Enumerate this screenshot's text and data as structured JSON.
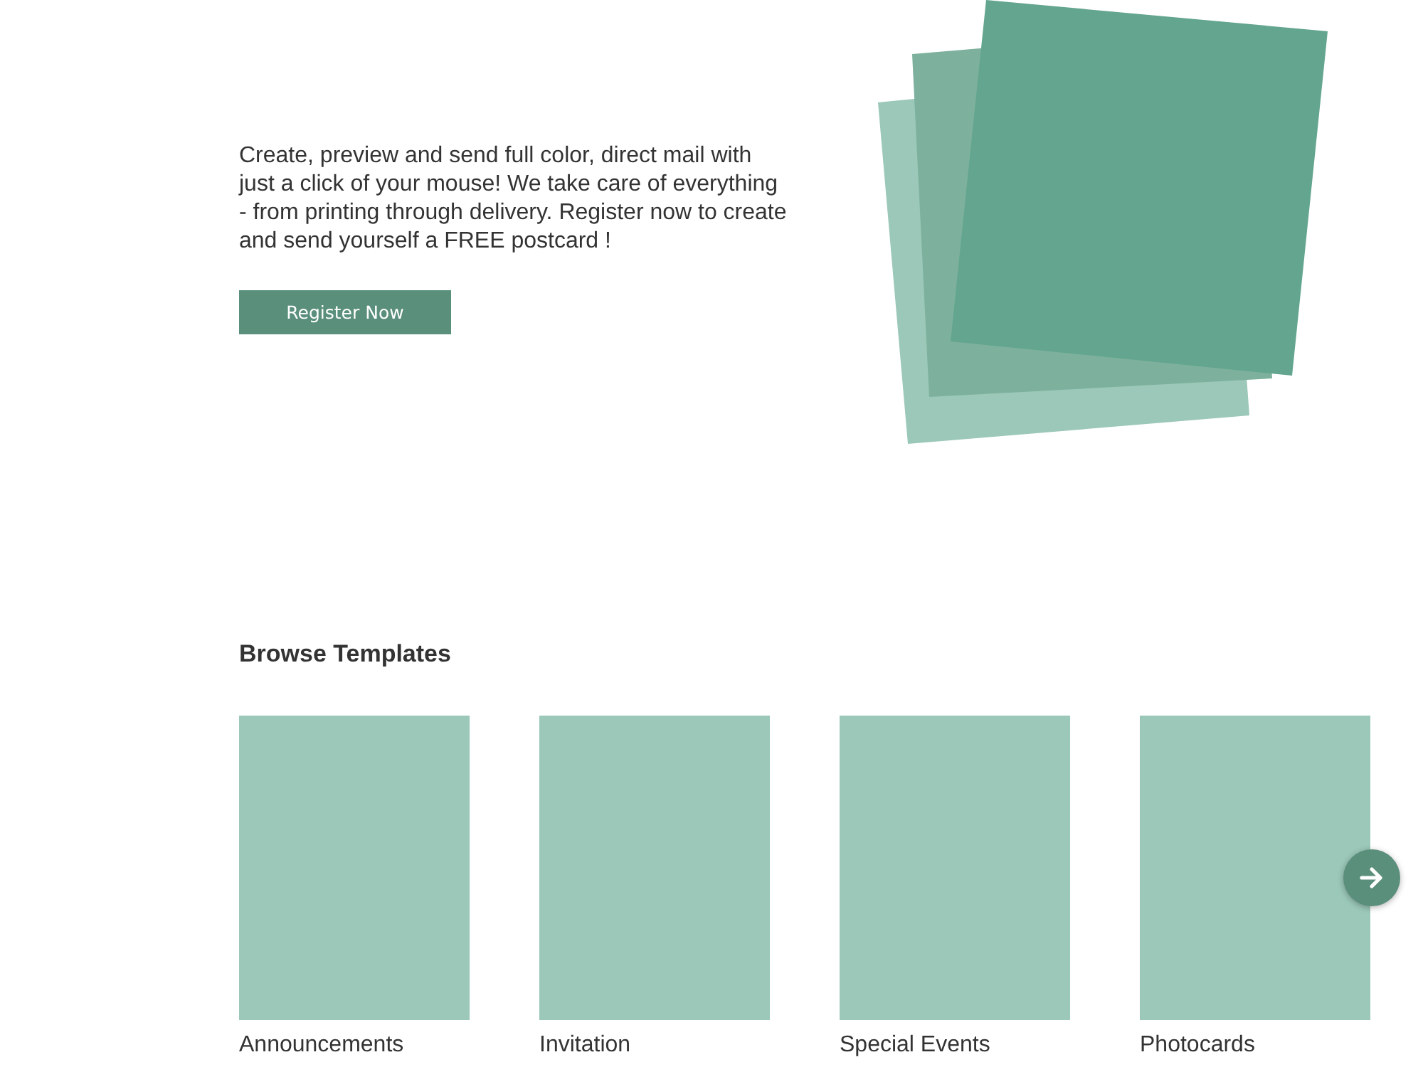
{
  "hero": {
    "description": "Create, preview and send full color, direct mail with just a click of your mouse! We take care of everything - from printing through delivery. Register now to create and send yourself a FREE postcard !",
    "button": "Register Now"
  },
  "browse": {
    "title": "Browse Templates",
    "templates": [
      {
        "label": "Announcements"
      },
      {
        "label": "Invitation"
      },
      {
        "label": "Special Events"
      },
      {
        "label": "Photocards"
      }
    ]
  }
}
